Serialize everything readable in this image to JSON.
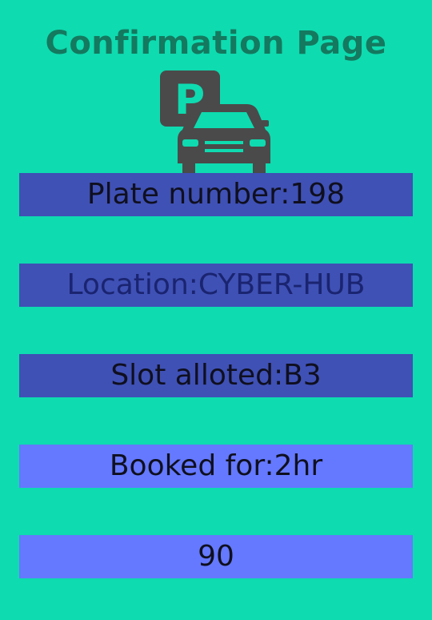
{
  "page": {
    "title": "Confirmation Page"
  },
  "logo": {
    "icon": "parking-car-icon",
    "sign_letter": "P"
  },
  "booking": {
    "plate_number": "Plate number:198",
    "location": "Location:CYBER-HUB",
    "slot": "Slot alloted:B3",
    "duration": "Booked for:2hr",
    "amount": "90"
  },
  "colors": {
    "background": "#0edbb0",
    "title": "#14795f",
    "field_dark": "#3f51b5",
    "field_light": "#6479ff",
    "icon": "#4a4a4a"
  }
}
